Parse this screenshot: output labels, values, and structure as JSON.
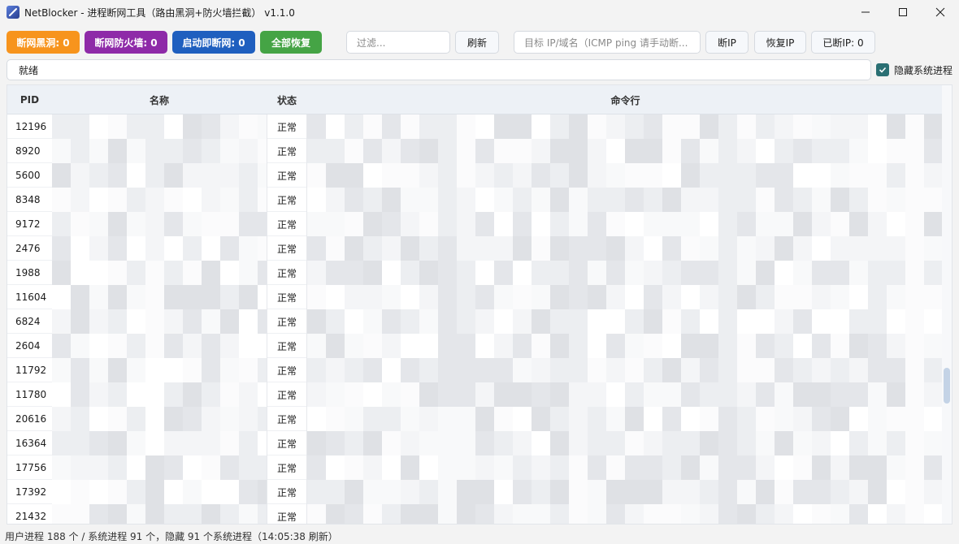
{
  "window": {
    "title": "NetBlocker - 进程断网工具（路由黑洞+防火墙拦截） v1.1.0"
  },
  "toolbar": {
    "blackhole_label": "断网黑洞: 0",
    "firewall_label": "断网防火墙: 0",
    "startup_label": "启动即断网: 0",
    "restore_all_label": "全部恢复",
    "filter_placeholder": "过滤...",
    "refresh_label": "刷新",
    "target_placeholder": "目标 IP/域名（ICMP ping 请手动断...",
    "block_ip_label": "断IP",
    "restore_ip_label": "恢复IP",
    "blocked_ip_label": "已断IP: 0",
    "colors": {
      "blackhole": "#f7941d",
      "firewall": "#8e2aa8",
      "startup": "#1f5fbf",
      "restore_all": "#45a445"
    }
  },
  "status": {
    "text": "就绪",
    "hide_system_label": "隐藏系统进程",
    "hide_system_checked": true
  },
  "table": {
    "headers": {
      "pid": "PID",
      "name": "名称",
      "status": "状态",
      "cmdline": "命令行"
    },
    "rows": [
      {
        "pid": "12196",
        "status": "正常"
      },
      {
        "pid": "8920",
        "status": "正常"
      },
      {
        "pid": "5600",
        "status": "正常"
      },
      {
        "pid": "8348",
        "status": "正常"
      },
      {
        "pid": "9172",
        "status": "正常"
      },
      {
        "pid": "2476",
        "status": "正常"
      },
      {
        "pid": "1988",
        "status": "正常"
      },
      {
        "pid": "11604",
        "status": "正常"
      },
      {
        "pid": "6824",
        "status": "正常"
      },
      {
        "pid": "2604",
        "status": "正常"
      },
      {
        "pid": "11792",
        "status": "正常"
      },
      {
        "pid": "11780",
        "status": "正常"
      },
      {
        "pid": "20616",
        "status": "正常"
      },
      {
        "pid": "16364",
        "status": "正常"
      },
      {
        "pid": "17756",
        "status": "正常"
      },
      {
        "pid": "17392",
        "status": "正常"
      },
      {
        "pid": "21432",
        "status": "正常"
      }
    ]
  },
  "footer": {
    "text": "用户进程 188 个 / 系统进程 91 个，隐藏 91 个系统进程（14:05:38 刷新）"
  }
}
